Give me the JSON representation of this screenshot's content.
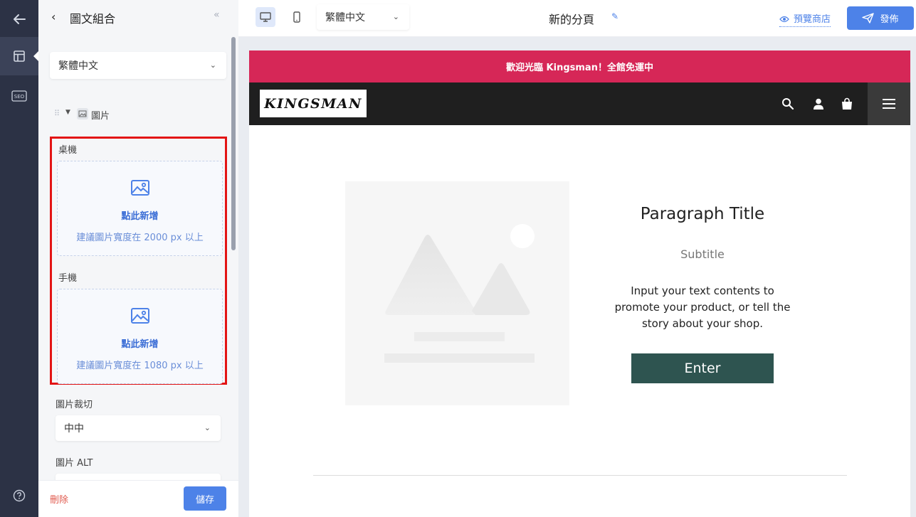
{
  "rail": {
    "back_icon": "arrow-left-icon",
    "items": [
      {
        "icon": "layout-icon",
        "active": true
      },
      {
        "icon": "seo-icon",
        "label": "SEO"
      }
    ],
    "help_icon": "question-icon"
  },
  "panel": {
    "title": "圖文組合",
    "language": "繁體中文",
    "block": {
      "label": "圖片"
    },
    "desktop": {
      "label": "桌機",
      "add": "點此新增",
      "hint": "建議圖片寬度在 2000 px 以上"
    },
    "mobile": {
      "label": "手機",
      "add": "點此新增",
      "hint": "建議圖片寬度在 1080 px 以上"
    },
    "crop": {
      "label": "圖片裁切",
      "value": "中中"
    },
    "alt": {
      "label": "圖片 ALT",
      "value": ""
    },
    "delete": "刪除",
    "save": "儲存"
  },
  "topbar": {
    "language": "繁體中文",
    "page_name": "新的分頁",
    "preview": "預覽商店",
    "publish": "發佈",
    "accent": "#4d82e8"
  },
  "store": {
    "announcement": "歡迎光臨 Kingsman！全館免運中",
    "logo": "KINGSMAN",
    "title": "Paragraph Title",
    "subtitle": "Subtitle",
    "body": "Input your text contents to promote your product, or tell the story about your shop.",
    "button": "Enter",
    "colors": {
      "announcement": "#d62757",
      "nav": "#1f1f1f",
      "button": "#2e5450"
    }
  }
}
